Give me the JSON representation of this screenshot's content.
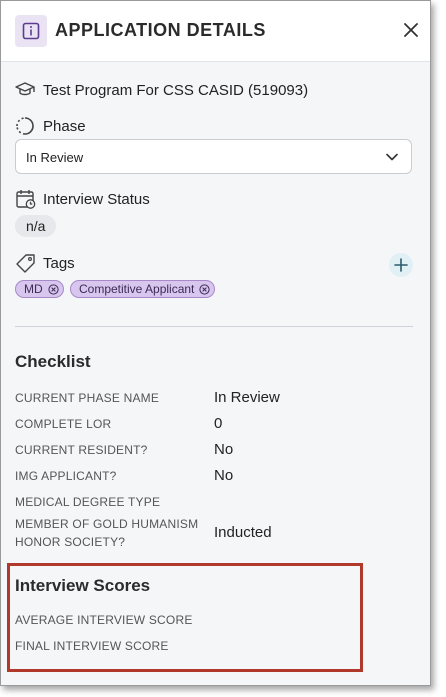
{
  "header": {
    "title": "APPLICATION DETAILS",
    "info_icon": "info-icon",
    "close_icon": "close-icon"
  },
  "program": {
    "icon": "graduation-cap-icon",
    "label": "Test Program For CSS CASID (519093)"
  },
  "phase": {
    "icon": "phase-progress-icon",
    "label": "Phase",
    "selected": "In Review"
  },
  "interview_status": {
    "icon": "calendar-clock-icon",
    "label": "Interview Status",
    "value": "n/a"
  },
  "tags": {
    "icon": "tag-icon",
    "label": "Tags",
    "add_icon": "plus-icon",
    "items": [
      {
        "label": "MD"
      },
      {
        "label": "Competitive Applicant"
      }
    ]
  },
  "checklist": {
    "title": "Checklist",
    "rows": [
      {
        "label": "CURRENT PHASE NAME",
        "value": "In Review"
      },
      {
        "label": "COMPLETE LOR",
        "value": "0"
      },
      {
        "label": "CURRENT RESIDENT?",
        "value": "No"
      },
      {
        "label": "IMG APPLICANT?",
        "value": "No"
      },
      {
        "label": "MEDICAL DEGREE TYPE",
        "value": ""
      },
      {
        "label": "MEMBER OF GOLD HUMANISM HONOR SOCIETY?",
        "value": "Inducted"
      }
    ]
  },
  "interview_scores": {
    "title": "Interview Scores",
    "rows": [
      {
        "label": "AVERAGE INTERVIEW SCORE",
        "value": ""
      },
      {
        "label": "FINAL INTERVIEW SCORE",
        "value": ""
      }
    ]
  },
  "colors": {
    "accent": "#7a5aa8",
    "tag_bg": "#d9c6ee",
    "highlight": "#b0392b",
    "panel_bg": "#f5f6f8"
  }
}
